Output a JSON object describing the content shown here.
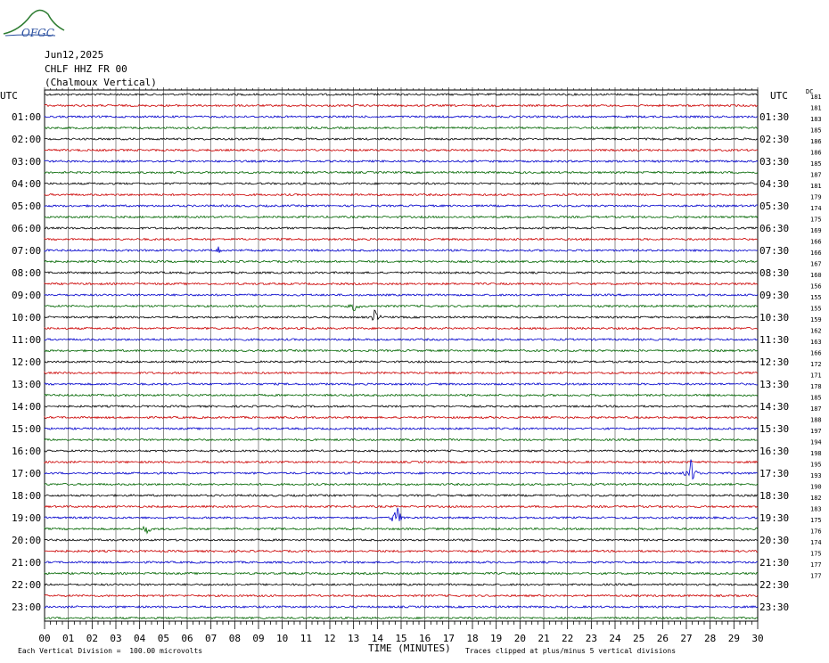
{
  "logo_text": "OFGC",
  "header": {
    "date": "Jun12,2025",
    "station": "CHLF HHZ FR 00",
    "location": "(Chalmoux Vertical)"
  },
  "left_axis_label": "UTC",
  "right_axis_label": "UTC",
  "dc_label": "DC",
  "colors": {
    "trace_cycle": [
      "#000000",
      "#cc0000",
      "#0000cc",
      "#006600"
    ],
    "grid": "#000000"
  },
  "chart_data": {
    "type": "line",
    "xlabel": "TIME (MINUTES)",
    "xlim": [
      0,
      30
    ],
    "x_ticks": [
      "00",
      "01",
      "02",
      "03",
      "04",
      "05",
      "06",
      "07",
      "08",
      "09",
      "10",
      "11",
      "12",
      "13",
      "14",
      "15",
      "16",
      "17",
      "18",
      "19",
      "20",
      "21",
      "22",
      "23",
      "24",
      "25",
      "26",
      "27",
      "28",
      "29",
      "30"
    ],
    "left_hour_labels": [
      "01:00",
      "02:00",
      "03:00",
      "04:00",
      "05:00",
      "06:00",
      "07:00",
      "08:00",
      "09:00",
      "10:00",
      "11:00",
      "12:00",
      "13:00",
      "14:00",
      "15:00",
      "16:00",
      "17:00",
      "18:00",
      "19:00",
      "20:00",
      "21:00",
      "22:00",
      "23:00"
    ],
    "right_hour_labels": [
      "01:30",
      "02:30",
      "03:30",
      "04:30",
      "05:30",
      "06:30",
      "07:30",
      "08:30",
      "09:30",
      "10:30",
      "11:30",
      "12:30",
      "13:30",
      "14:30",
      "15:30",
      "16:30",
      "17:30",
      "18:30",
      "19:30",
      "20:30",
      "21:30",
      "22:30",
      "23:30"
    ],
    "trace_count": 48,
    "dc_offsets": [
      181,
      181,
      183,
      185,
      186,
      186,
      185,
      187,
      181,
      179,
      174,
      175,
      169,
      166,
      166,
      167,
      160,
      156,
      155,
      155,
      159,
      162,
      163,
      166,
      172,
      171,
      178,
      185,
      187,
      188,
      197,
      194,
      198,
      195,
      193,
      190,
      182,
      183,
      175,
      176,
      174,
      175,
      177,
      177
    ],
    "events": [
      {
        "trace": 14,
        "minute": 7.3,
        "amplitude": 0.5
      },
      {
        "trace": 19,
        "minute": 13.0,
        "amplitude": 1.0
      },
      {
        "trace": 20,
        "minute": 13.9,
        "amplitude": 1.0
      },
      {
        "trace": 34,
        "minute": 27.2,
        "amplitude": 2.0
      },
      {
        "trace": 38,
        "minute": 14.8,
        "amplitude": 2.0
      },
      {
        "trace": 39,
        "minute": 4.3,
        "amplitude": 0.8
      }
    ],
    "vertical_division": "Each Vertical Division =  100.00 microvolts",
    "clip_note": "Traces clipped at plus/minus 5 vertical divisions",
    "grid": true
  }
}
